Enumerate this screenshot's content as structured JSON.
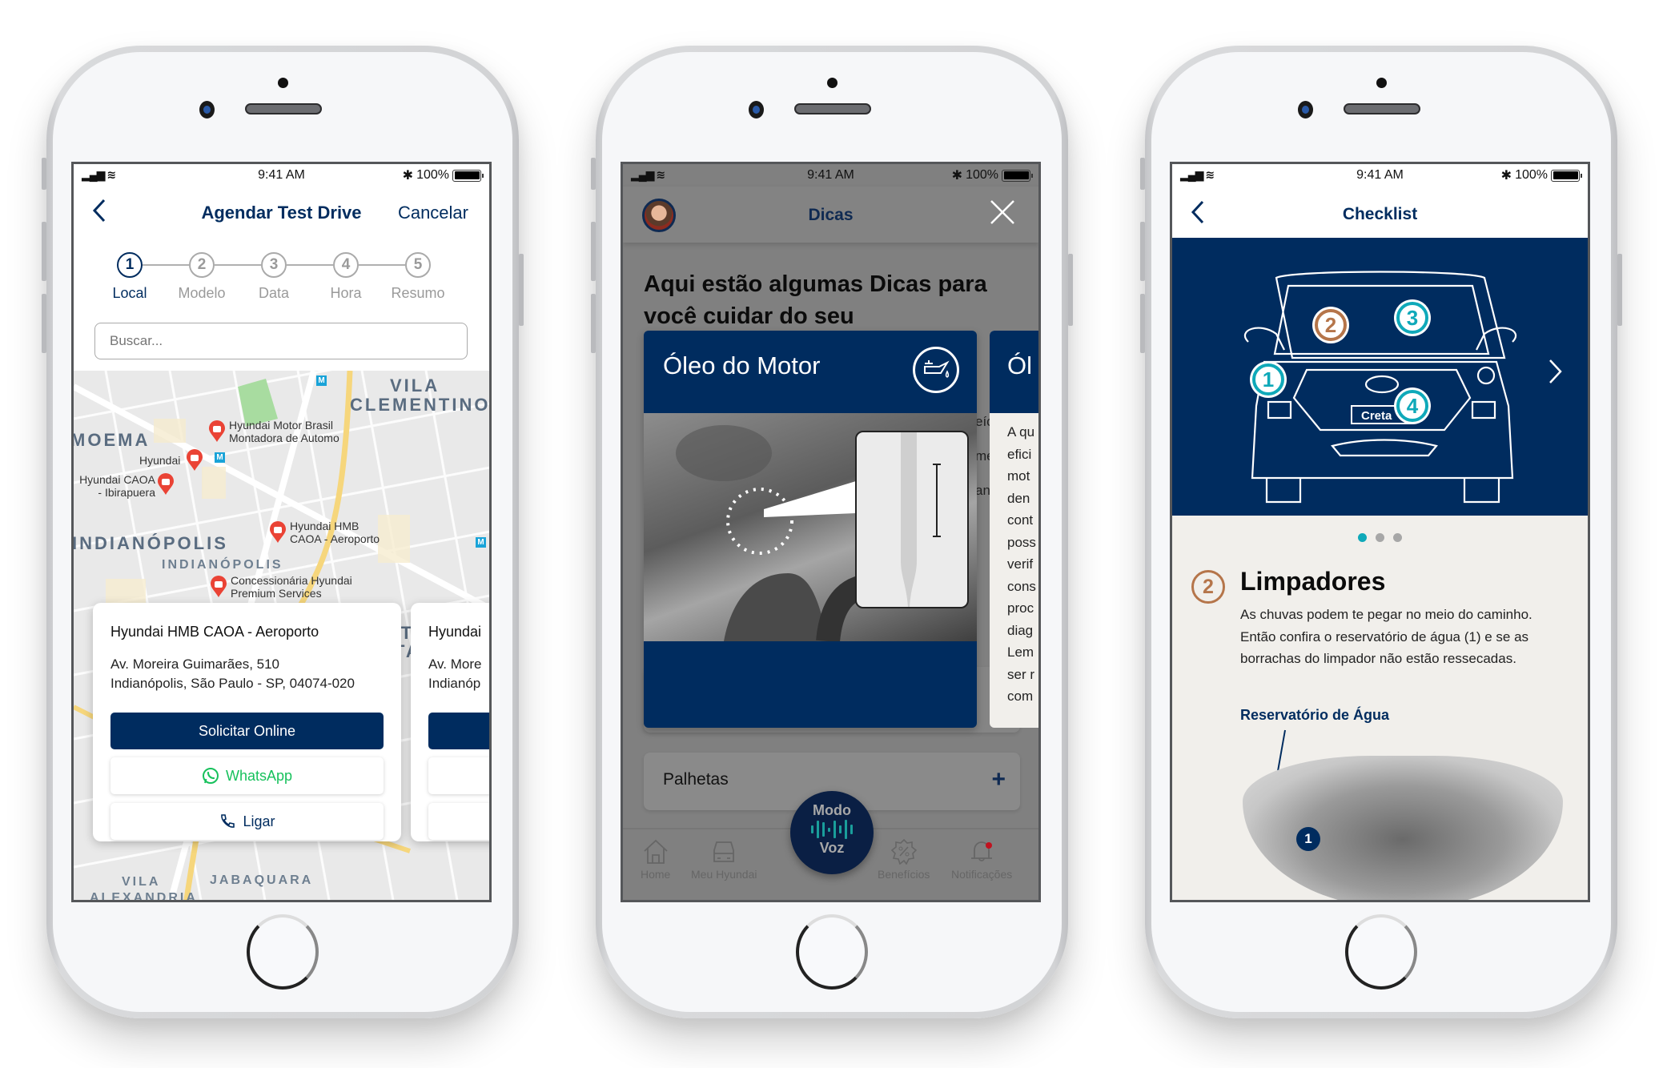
{
  "status_bar": {
    "time": "9:41 AM",
    "battery": "100%",
    "signal_icon": "signal-icon",
    "wifi_icon": "wifi-icon",
    "bluetooth_icon": "bluetooth-icon"
  },
  "colors": {
    "brand_navy": "#002c5f",
    "teal": "#0fa9b9",
    "brown": "#b5754a",
    "whatsapp_green": "#17c15c",
    "beige_bg": "#f1efeb"
  },
  "phone1": {
    "header": {
      "title": "Agendar Test Drive",
      "cancel": "Cancelar",
      "back_icon": "chevron-left-icon"
    },
    "steps": [
      {
        "num": "1",
        "label": "Local",
        "active": true
      },
      {
        "num": "2",
        "label": "Modelo",
        "active": false
      },
      {
        "num": "3",
        "label": "Data",
        "active": false
      },
      {
        "num": "4",
        "label": "Hora",
        "active": false
      },
      {
        "num": "5",
        "label": "Resumo",
        "active": false
      }
    ],
    "search": {
      "placeholder": "Buscar...",
      "value": ""
    },
    "map": {
      "areas": [
        "VILA",
        "CLEMENTINO",
        "MOEMA",
        "INDIANÓPOLIS",
        "INDIANÓPOLIS",
        "PLANALTO",
        "PAULISTA",
        "VILA",
        "VILA",
        "ALEXANDRIA",
        "JABAQUARA"
      ],
      "pins": [
        {
          "name": "Hyundai Motor Brasil",
          "line2": "Montadora de Automo"
        },
        {
          "name": "Hyundai",
          "line2": ""
        },
        {
          "name": "Hyundai CAOA",
          "line2": "- Ibirapuera"
        },
        {
          "name": "Hyundai HMB",
          "line2": "CAOA - Aeroporto"
        },
        {
          "name": "Concessionária Hyundai",
          "line2": "Premium Services"
        }
      ],
      "metro_label": "M"
    },
    "cards": [
      {
        "title": "Hyundai HMB CAOA - Aeroporto",
        "address_line1": "Av. Moreira Guimarães, 510",
        "address_line2": "Indianópolis, São Paulo - SP, 04074-020",
        "primary_button": "Solicitar Online",
        "whatsapp_button": "WhatsApp",
        "call_button": "Ligar"
      },
      {
        "title": "Hyundai",
        "address_line1": "Av. More",
        "address_line2": "Indianóp"
      }
    ]
  },
  "phone2": {
    "header": {
      "title": "Dicas",
      "close_icon": "close-icon",
      "avatar": "assistant-avatar"
    },
    "heading": "Aqui estão algumas Dicas para você cuidar do seu",
    "tip_card": {
      "title": "Óleo do Motor",
      "icon": "oil-can-icon"
    },
    "next_card": {
      "title": "Ól",
      "text_lines": [
        "A qu",
        "efici",
        "mot",
        "den",
        "cont",
        "poss",
        "verif",
        "cons",
        "proc",
        "diag",
        "Lem",
        "ser r",
        "com"
      ]
    },
    "behind_fragments": [
      "eíc",
      "me",
      "an"
    ],
    "accordion": {
      "label": "Palhetas",
      "expand_icon": "plus-icon"
    },
    "voice_button": {
      "line1": "Modo",
      "line2": "Voz"
    },
    "tabs": [
      {
        "label": "Home",
        "icon": "home-icon"
      },
      {
        "label": "Meu Hyundai",
        "icon": "car-icon"
      },
      {
        "label": "Benefícios",
        "icon": "percent-badge-icon"
      },
      {
        "label": "Notificações",
        "icon": "bell-icon",
        "badge": true
      }
    ]
  },
  "phone3": {
    "header": {
      "title": "Checklist",
      "back_icon": "chevron-left-icon"
    },
    "hero": {
      "car_badge": "Creta",
      "hotspots": [
        "1",
        "2",
        "3",
        "4"
      ],
      "next_icon": "chevron-right-icon"
    },
    "pagination": {
      "total": 3,
      "active": 1
    },
    "item": {
      "number": "2",
      "title": "Limpadores",
      "description": "As chuvas podem te pegar no meio do caminho. Então confira o reservatório de água (1) e se as borrachas do limpador não estão ressecadas.",
      "callout_label": "Reservatório de Água",
      "callout_number": "1"
    }
  }
}
